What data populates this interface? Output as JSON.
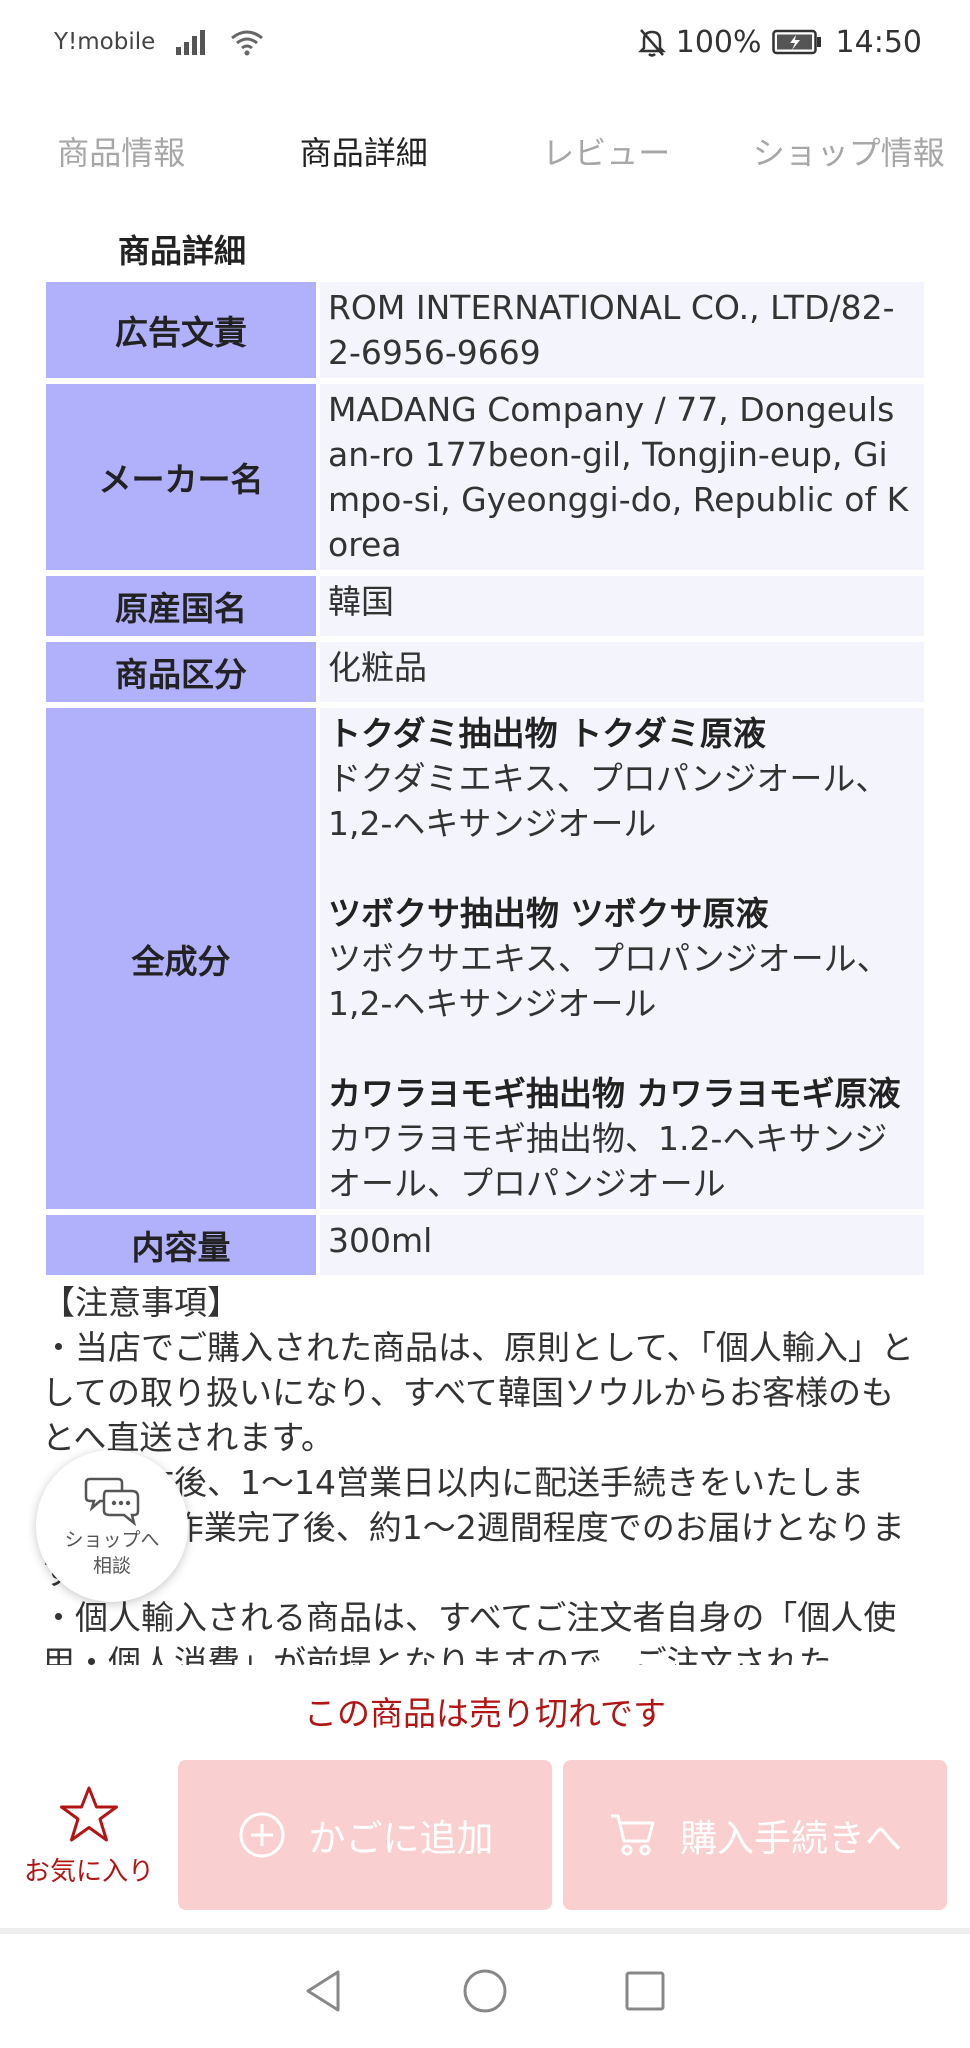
{
  "status_bar": {
    "carrier": "Y!mobile",
    "battery": "100%",
    "time": "14:50"
  },
  "tabs": [
    {
      "label": "商品情報",
      "active": false
    },
    {
      "label": "商品詳細",
      "active": true
    },
    {
      "label": "レビュー",
      "active": false
    },
    {
      "label": "ショップ情報",
      "active": false
    }
  ],
  "details": {
    "title": "商品詳細",
    "rows": [
      {
        "label": "広告文責",
        "value": "ROM INTERNATIONAL CO., LTD/82-2-6956-9669"
      },
      {
        "label": "メーカー名",
        "value": "MADANG Company / 77, Dongeulsan-ro 177beon-gil, Tongjin-eup, Gimpo-si, Gyeonggi-do, Republic of Korea"
      },
      {
        "label": "原産国名",
        "value": "韓国"
      },
      {
        "label": "商品区分",
        "value": "化粧品"
      },
      {
        "label": "全成分",
        "ingredients": [
          {
            "name": "トクダミ抽出物 トクダミ原液",
            "list": "ドクダミエキス、プロパンジオール、1,2-ヘキサンジオール"
          },
          {
            "name": "ツボクサ抽出物 ツボクサ原液",
            "list": "ツボクサエキス、プロパンジオール、1,2-ヘキサンジオール"
          },
          {
            "name": "カワラヨモギ抽出物 カワラヨモギ原液",
            "list": "カワラヨモギ抽出物、1.2-ヘキサンジオール、プロパンジオール"
          }
        ]
      },
      {
        "label": "内容量",
        "value": "300ml"
      }
    ]
  },
  "notes": {
    "heading": "【注意事項】",
    "lines": [
      "・当店でご購入された商品は、原則として、「個人輸入」としての取り扱いになり、すべて韓国ソウルからお客様のもとへ直送されます。",
      "・ご注文後、1～14営業日以内に配送手続きをいたします。配送作業完了後、約1～2週間程度でのお届けとなります。",
      "・個人輸入される商品は、すべてご注文者自身の「個人使用・個人消費」が前提となりますので、ご注文された"
    ]
  },
  "fab": {
    "line1": "ショップへ",
    "line2": "相談"
  },
  "bottom": {
    "sold_out": "この商品は売り切れです",
    "favorite_label": "お気に入り",
    "cart_label": "かごに追加",
    "buy_label": "購入手続きへ"
  },
  "colors": {
    "header_cell": "#b0b1fa",
    "value_cell": "#f4f4fd",
    "sold_out_red": "#b31414",
    "disabled_button": "#f9cfcf"
  }
}
